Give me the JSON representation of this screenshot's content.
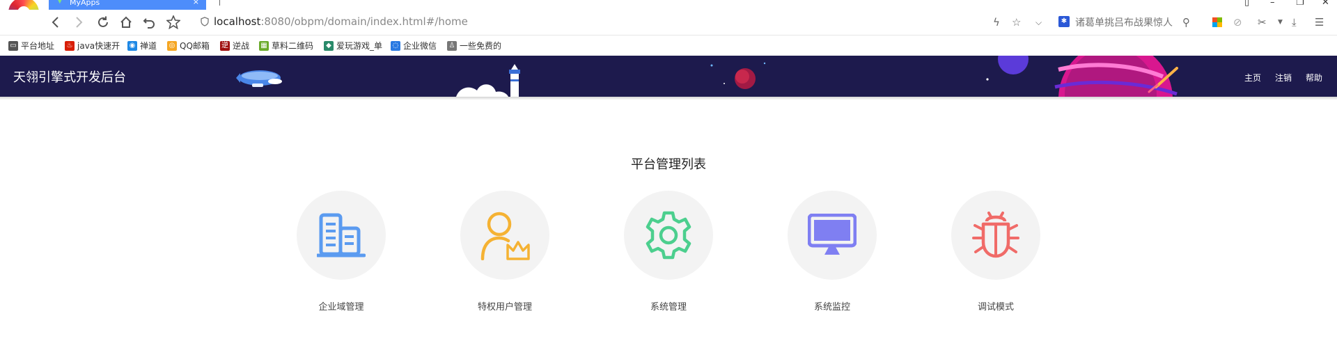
{
  "browser": {
    "tab_title": "MyApps",
    "tab_close": "×",
    "url_host": "localhost",
    "url_rest": ":8080/obpm/domain/index.html#/home",
    "search_placeholder": "诸葛单挑吕布战果惊人"
  },
  "bookmarks": [
    {
      "label": "平台地址",
      "icon": "folder-icon",
      "color": "#555555"
    },
    {
      "label": "java快速开",
      "icon": "java-icon",
      "color": "#d81e06"
    },
    {
      "label": "禅道",
      "icon": "zentao-icon",
      "color": "#1e88e5"
    },
    {
      "label": "QQ邮箱",
      "icon": "qqmail-icon",
      "color": "#f5a623"
    },
    {
      "label": "逆战",
      "icon": "nizhan-icon",
      "color": "#a01010"
    },
    {
      "label": "草料二维码",
      "icon": "qrcode-icon",
      "color": "#6aaa2a"
    },
    {
      "label": "爱玩游戏_单",
      "icon": "game-icon",
      "color": "#2a8a6a"
    },
    {
      "label": "企业微信",
      "icon": "wecom-icon",
      "color": "#2a7ae2"
    },
    {
      "label": "一些免费的",
      "icon": "user-icon",
      "color": "#777777"
    }
  ],
  "header": {
    "title": "天翎引擎式开发后台",
    "nav": [
      "主页",
      "注销",
      "帮助"
    ],
    "background": "#1d1a4d"
  },
  "main": {
    "title": "平台管理列表",
    "items": [
      {
        "label": "企业域管理",
        "icon": "building-icon",
        "color": "#5b9bf0"
      },
      {
        "label": "特权用户管理",
        "icon": "admin-user-icon",
        "color": "#f5b233"
      },
      {
        "label": "系统管理",
        "icon": "gear-icon",
        "color": "#4ccf8e"
      },
      {
        "label": "系统监控",
        "icon": "monitor-icon",
        "color": "#7f7ff2"
      },
      {
        "label": "调试模式",
        "icon": "bug-icon",
        "color": "#f06b68"
      }
    ]
  }
}
